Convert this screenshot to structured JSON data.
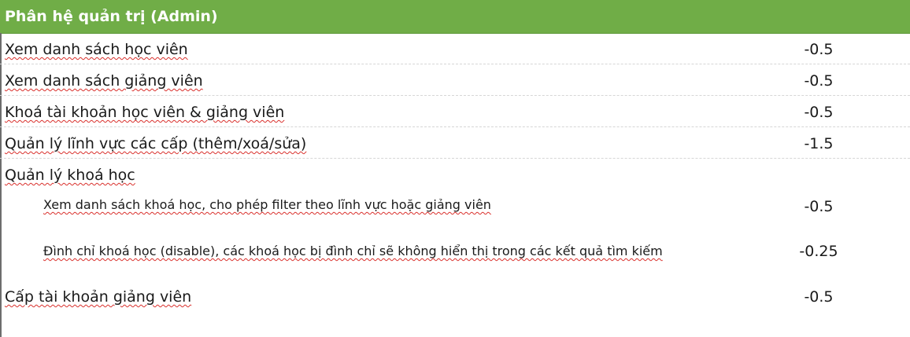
{
  "header": {
    "title": "Phân hệ quản trị (Admin)"
  },
  "rows": [
    {
      "label": "Xem danh sách học viên",
      "value": "-0.5"
    },
    {
      "label": "Xem danh sách giảng viên",
      "value": "-0.5"
    },
    {
      "label": "Khoá tài khoản học viên & giảng viên",
      "value": "-0.5"
    },
    {
      "label": "Quản lý lĩnh vực các cấp (thêm/xoá/sửa)",
      "value": "-1.5"
    },
    {
      "label": "Quản lý khoá học",
      "value": ""
    },
    {
      "label": "Xem danh sách khoá học, cho phép filter theo lĩnh vực hoặc giảng viên",
      "value": "-0.5"
    },
    {
      "label": "Đình chỉ khoá học (disable), các khoá học bị đình chỉ sẽ không hiển thị trong các kết quả tìm kiếm",
      "value": "-0.25"
    },
    {
      "label": "Cấp tài khoản giảng viên",
      "value": "-0.5"
    }
  ],
  "colors": {
    "header_bg": "#70ad47",
    "header_text": "#ffffff",
    "spellcheck_underline": "#d9302c"
  }
}
